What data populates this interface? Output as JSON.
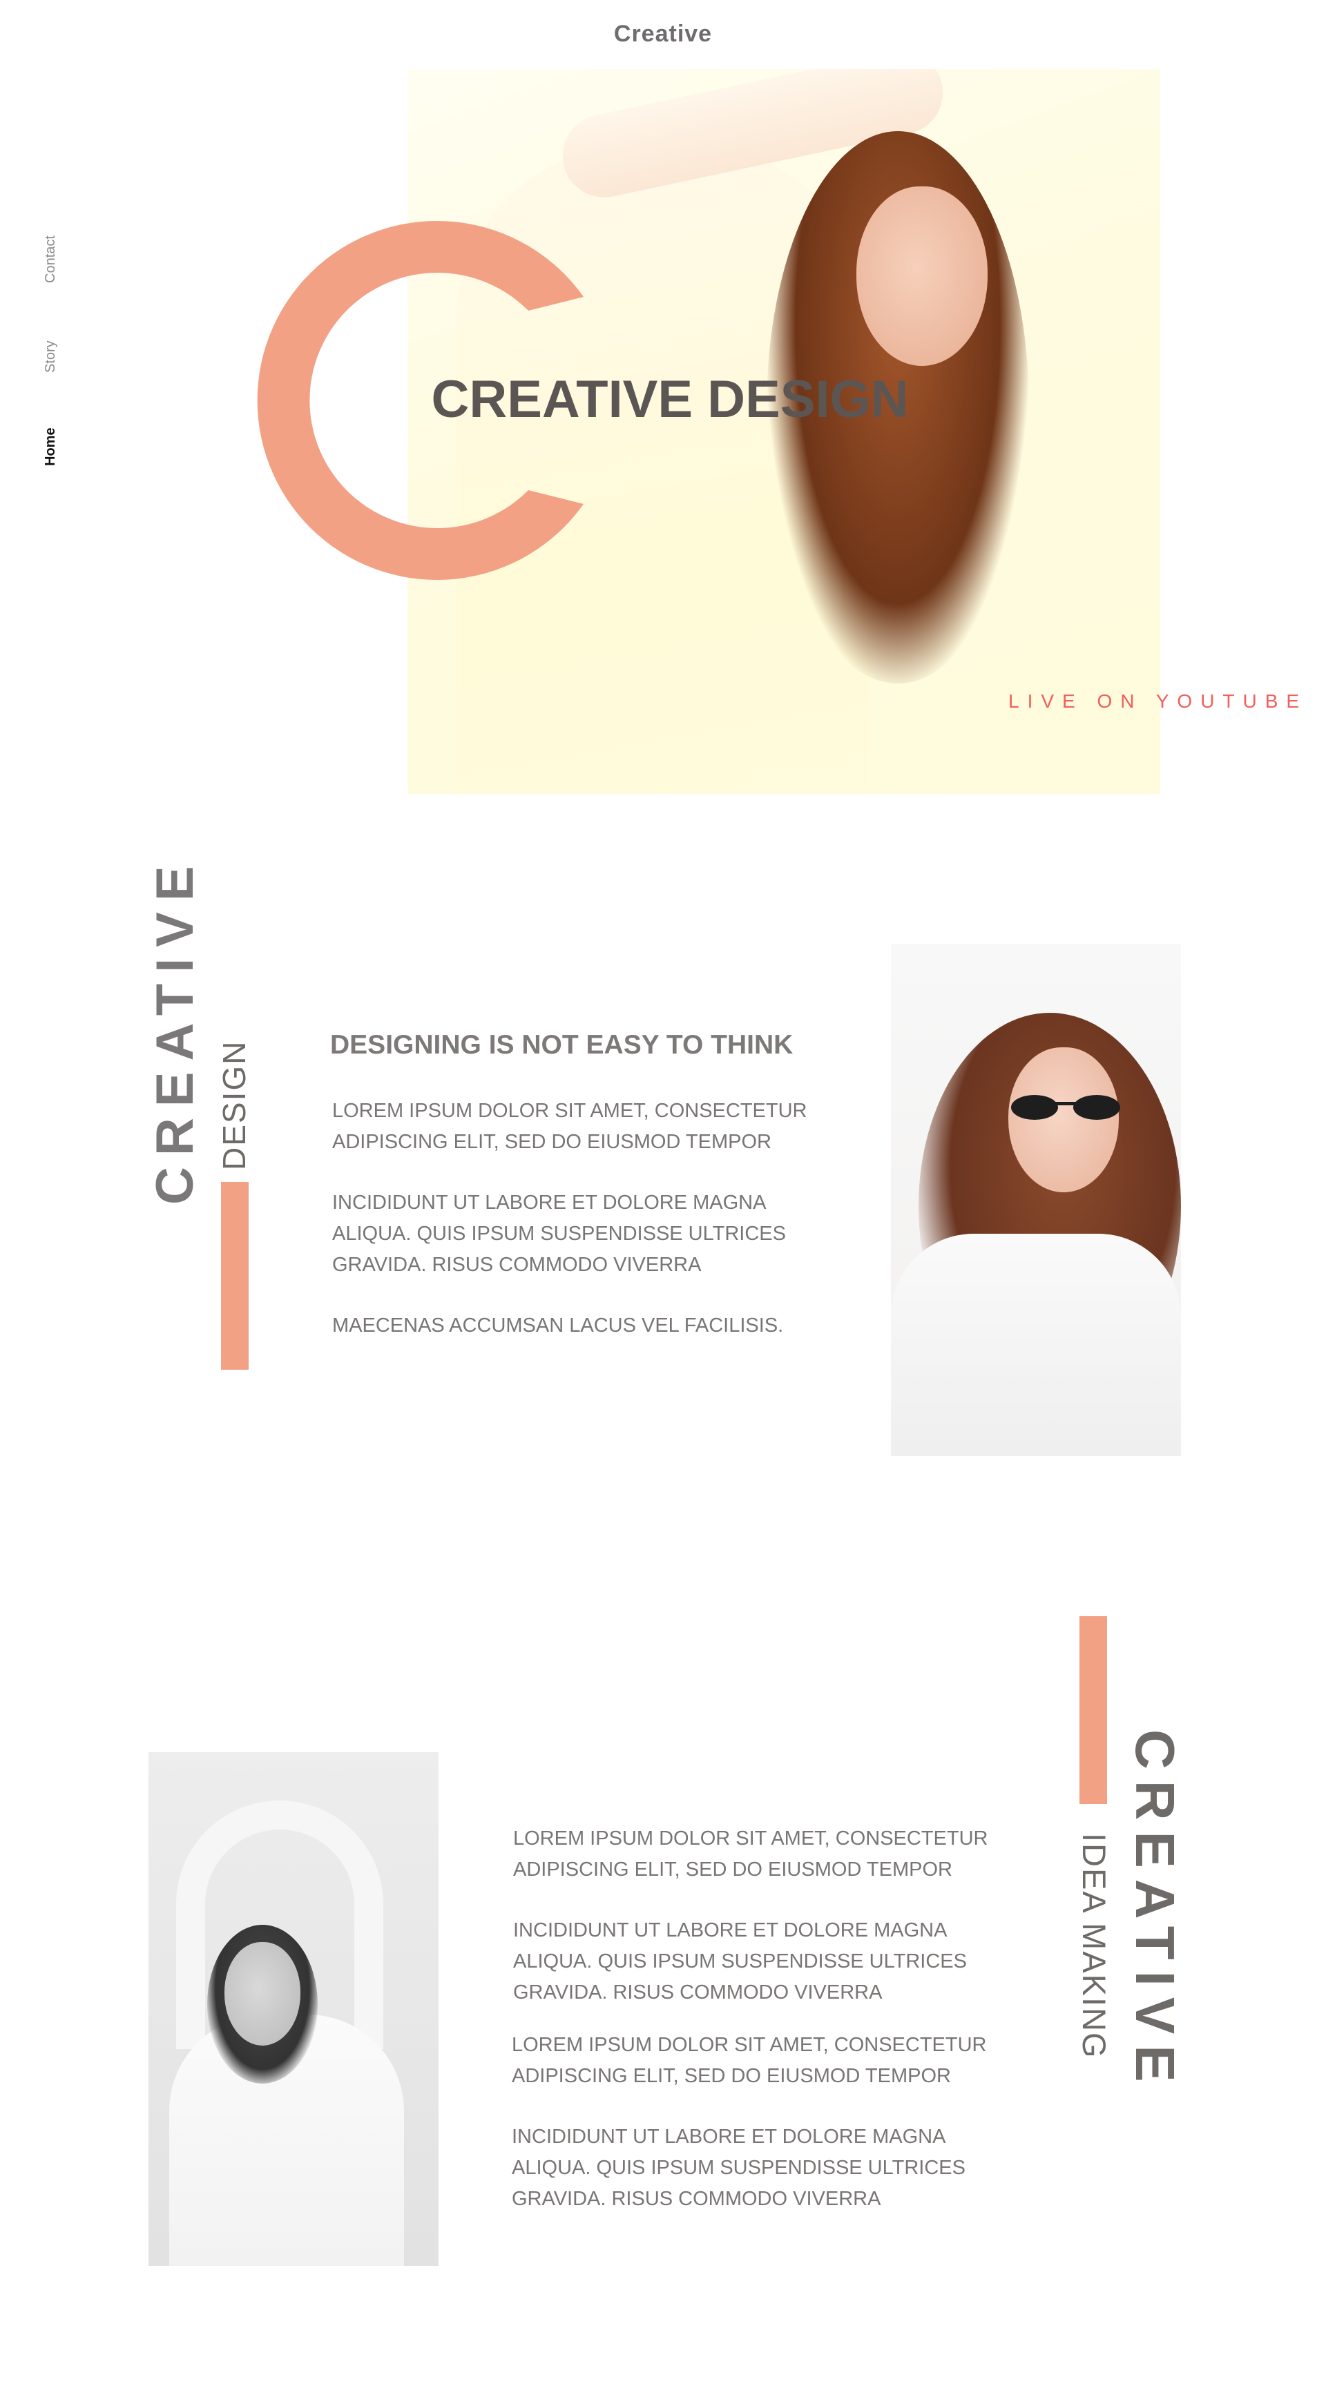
{
  "header": {
    "brand": "Creative"
  },
  "nav": {
    "items": [
      {
        "label": "Contact",
        "active": false
      },
      {
        "label": "Story",
        "active": false
      },
      {
        "label": "Home",
        "active": true
      }
    ]
  },
  "hero": {
    "big_letter": "C",
    "title": "CREATIVE DESIGN",
    "cta": "LIVE ON YOUTUBE"
  },
  "section_story": {
    "vertical_big": "CREATIVE",
    "vertical_mid": "DESIGN",
    "heading": "DESIGNING IS NOT EASY TO THINK",
    "paragraphs": [
      [
        "LOREM IPSUM DOLOR SIT AMET, CONSECTETUR",
        "ADIPISCING ELIT, SED DO EIUSMOD TEMPOR"
      ],
      [
        "INCIDIDUNT UT LABORE ET DOLORE MAGNA",
        "ALIQUA. QUIS IPSUM SUSPENDISSE ULTRICES",
        "GRAVIDA. RISUS COMMODO VIVERRA"
      ],
      [
        "MAECENAS ACCUMSAN LACUS VEL FACILISIS."
      ]
    ]
  },
  "section_ideas": {
    "vertical_big": "CREATIVE",
    "vertical_mid": "IDEA MAKING",
    "paragraphs": [
      [
        "LOREM IPSUM DOLOR SIT AMET, CONSECTETUR",
        "ADIPISCING ELIT, SED DO EIUSMOD TEMPOR"
      ],
      [
        "INCIDIDUNT UT LABORE ET DOLORE MAGNA",
        "ALIQUA. QUIS IPSUM SUSPENDISSE ULTRICES",
        "GRAVIDA. RISUS COMMODO VIVERRA"
      ],
      [
        "LOREM IPSUM DOLOR SIT AMET, CONSECTETUR",
        "ADIPISCING ELIT, SED DO EIUSMOD TEMPOR"
      ],
      [
        "INCIDIDUNT UT LABORE ET DOLORE MAGNA",
        "ALIQUA. QUIS IPSUM SUSPENDISSE ULTRICES",
        "GRAVIDA. RISUS COMMODO VIVERRA"
      ]
    ]
  },
  "colors": {
    "accent": "#f2a185",
    "cta": "#f25f5c",
    "text_dark": "#5b5654",
    "text_body": "#787574"
  }
}
